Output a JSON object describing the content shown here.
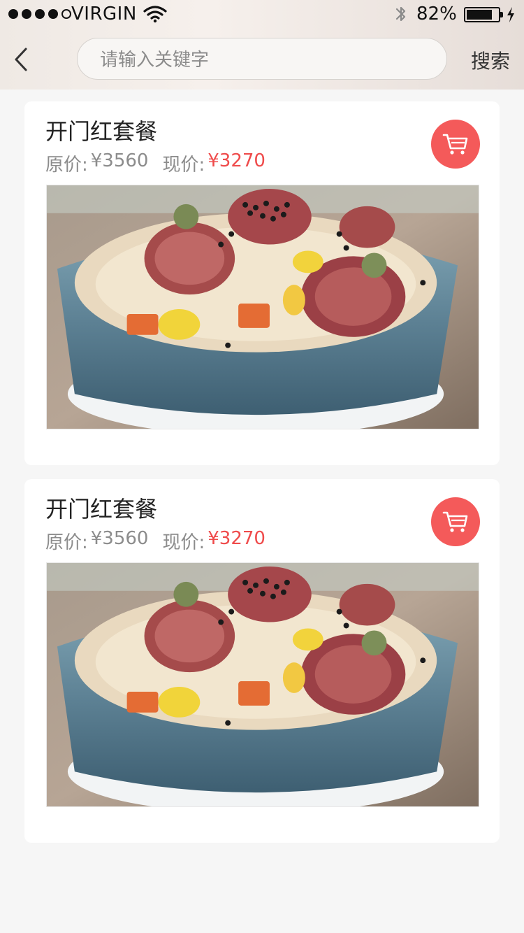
{
  "status_bar": {
    "carrier": "VIRGIN",
    "battery_percent": "82%",
    "battery_level": 0.82,
    "signal_filled": 4,
    "signal_total": 5
  },
  "search": {
    "placeholder": "请输入关键字",
    "button_label": "搜索"
  },
  "products": [
    {
      "title": "开门红套餐",
      "original_label": "原价:",
      "original_price": "¥3560",
      "current_label": "现价:",
      "current_price": "¥3270"
    },
    {
      "title": "开门红套餐",
      "original_label": "原价:",
      "original_price": "¥3560",
      "current_label": "现价:",
      "current_price": "¥3270"
    }
  ],
  "colors": {
    "accent_red": "#ef4b4b",
    "cart_button": "#f45a5a"
  },
  "icons": {
    "back": "back-arrow-icon",
    "cart": "cart-icon",
    "wifi": "wifi-icon",
    "bluetooth": "bluetooth-icon",
    "battery": "battery-icon",
    "charging": "charging-bolt-icon"
  }
}
